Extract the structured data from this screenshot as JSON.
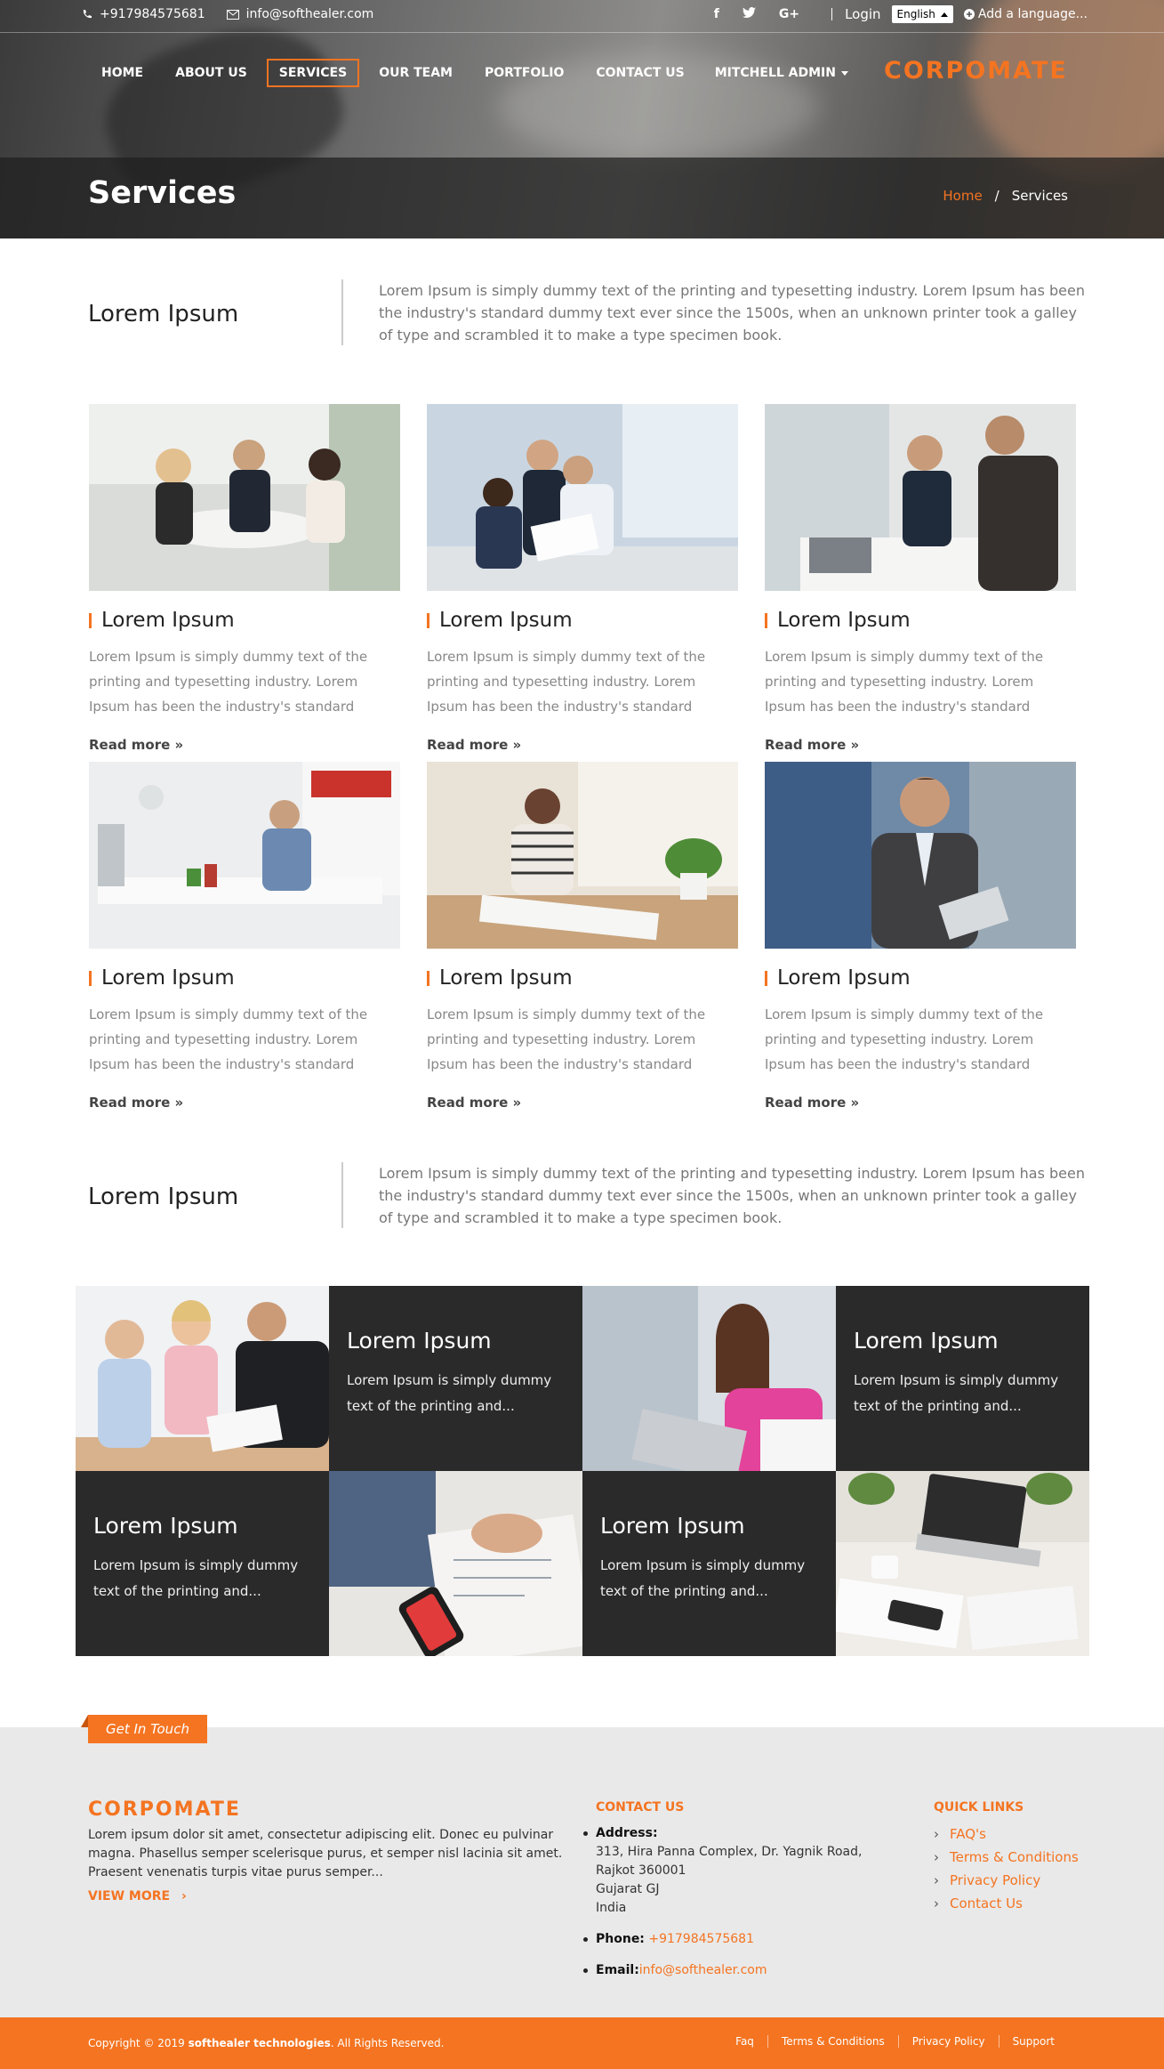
{
  "topbar": {
    "phone": "+917984575681",
    "email": "info@softhealer.com",
    "login": "Login",
    "language": "English",
    "add_language": "Add a language..."
  },
  "nav": {
    "items": [
      "HOME",
      "ABOUT US",
      "SERVICES",
      "OUR TEAM",
      "PORTFOLIO",
      "CONTACT US"
    ],
    "active": "SERVICES",
    "user": "MITCHELL ADMIN"
  },
  "brand": "CORPOMATE",
  "page": {
    "title": "Services",
    "breadcrumb_home": "Home",
    "breadcrumb_current": "Services"
  },
  "intro1": {
    "heading": "Lorem Ipsum",
    "text": "Lorem Ipsum is simply dummy text of the printing and typesetting industry. Lorem Ipsum has been the industry's standard dummy text ever since the 1500s, when an unknown printer took a galley of type and scrambled it to make a type specimen book."
  },
  "services": [
    {
      "title": "Lorem Ipsum",
      "text": "Lorem Ipsum is simply dummy text of the printing and typesetting industry. Lorem Ipsum has been the industry's standard dummy text...",
      "more": "Read more »"
    },
    {
      "title": "Lorem Ipsum",
      "text": "Lorem Ipsum is simply dummy text of the printing and typesetting industry. Lorem Ipsum has been the industry's standard dummy text...",
      "more": "Read more »"
    },
    {
      "title": "Lorem Ipsum",
      "text": "Lorem Ipsum is simply dummy text of the printing and typesetting industry. Lorem Ipsum has been the industry's standard dummy text...",
      "more": "Read more »"
    },
    {
      "title": "Lorem Ipsum",
      "text": "Lorem Ipsum is simply dummy text of the printing and typesetting industry. Lorem Ipsum has been the industry's standard dummy text...",
      "more": "Read more »"
    },
    {
      "title": "Lorem Ipsum",
      "text": "Lorem Ipsum is simply dummy text of the printing and typesetting industry. Lorem Ipsum has been the industry's standard dummy text...",
      "more": "Read more »"
    },
    {
      "title": "Lorem Ipsum",
      "text": "Lorem Ipsum is simply dummy text of the printing and typesetting industry. Lorem Ipsum has been the industry's standard dummy text...",
      "more": "Read more »"
    }
  ],
  "intro2": {
    "heading": "Lorem Ipsum",
    "text": "Lorem Ipsum is simply dummy text of the printing and typesetting industry. Lorem Ipsum has been the industry's standard dummy text ever since the 1500s, when an unknown printer took a galley of type and scrambled it to make a type specimen book."
  },
  "tiles": [
    {
      "title": "Lorem Ipsum",
      "text": "Lorem Ipsum is simply dummy text of the printing and..."
    },
    {
      "title": "Lorem Ipsum",
      "text": "Lorem Ipsum is simply dummy text of the printing and..."
    },
    {
      "title": "Lorem Ipsum",
      "text": "Lorem Ipsum is simply dummy text of the printing and..."
    },
    {
      "title": "Lorem Ipsum",
      "text": "Lorem Ipsum is simply dummy text of the printing and..."
    }
  ],
  "footer": {
    "get_in_touch": "Get In Touch",
    "about": "Lorem ipsum dolor sit amet, consectetur adipiscing elit. Donec eu pulvinar magna. Phasellus semper scelerisque purus, et semper nisl lacinia sit amet. Praesent venenatis turpis vitae purus semper...",
    "view_more": "VIEW MORE",
    "contact_heading": "CONTACT US",
    "address_label": "Address:",
    "address_lines": [
      "313, Hira Panna Complex, Dr. Yagnik Road,",
      "Rajkot 360001",
      "Gujarat GJ",
      "India"
    ],
    "phone_label": "Phone:",
    "phone": "+917984575681",
    "email_label": "Email:",
    "email": "info@softhealer.com",
    "quick_heading": "QUICK LINKS",
    "quick_links": [
      "FAQ's",
      "Terms & Conditions",
      "Privacy Policy",
      "Contact Us"
    ],
    "copyright_prefix": "Copyright © 2019",
    "copyright_company": "softhealer technologies",
    "copyright_suffix": ". All Rights Reserved.",
    "bottom_links": [
      "Faq",
      "Terms & Conditions",
      "Privacy Policy",
      "Support"
    ]
  },
  "colors": {
    "accent": "#f47421",
    "dark_tile": "#2a2a2a",
    "footer_bg": "#e9e9e9"
  }
}
